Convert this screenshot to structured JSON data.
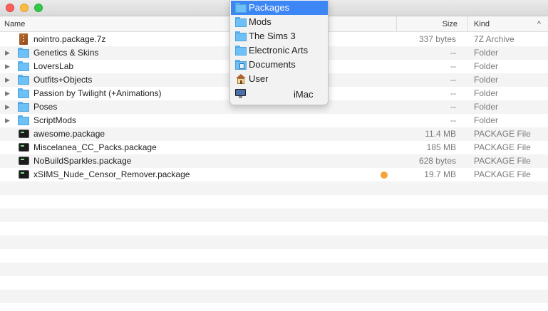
{
  "columns": {
    "name": "Name",
    "size": "Size",
    "kind": "Kind",
    "sort_indicator": "^"
  },
  "files": [
    {
      "name": "nointro.package.7z",
      "size": "337 bytes",
      "kind": "7Z Archive",
      "icon": "archive-icon",
      "expandable": false
    },
    {
      "name": "Genetics & Skins",
      "size": "--",
      "kind": "Folder",
      "icon": "folder-icon",
      "expandable": true
    },
    {
      "name": "LoversLab",
      "size": "--",
      "kind": "Folder",
      "icon": "folder-icon",
      "expandable": true
    },
    {
      "name": "Outfits+Objects",
      "size": "--",
      "kind": "Folder",
      "icon": "folder-icon",
      "expandable": true
    },
    {
      "name": "Passion by Twilight (+Animations)",
      "size": "--",
      "kind": "Folder",
      "icon": "folder-icon",
      "expandable": true
    },
    {
      "name": "Poses",
      "size": "--",
      "kind": "Folder",
      "icon": "folder-icon",
      "expandable": true
    },
    {
      "name": "ScriptMods",
      "size": "--",
      "kind": "Folder",
      "icon": "folder-icon",
      "expandable": true
    },
    {
      "name": "awesome.package",
      "size": "11.4 MB",
      "kind": "PACKAGE File",
      "icon": "terminal-icon",
      "expandable": false
    },
    {
      "name": "Miscelanea_CC_Packs.package",
      "size": "185 MB",
      "kind": "PACKAGE File",
      "icon": "terminal-icon",
      "expandable": false
    },
    {
      "name": "NoBuildSparkles.package",
      "size": "628 bytes",
      "kind": "PACKAGE File",
      "icon": "terminal-icon",
      "expandable": false
    },
    {
      "name": "xSIMS_Nude_Censor_Remover.package",
      "size": "19.7 MB",
      "kind": "PACKAGE File",
      "icon": "terminal-icon",
      "expandable": false,
      "tag_color": "#f5a33a"
    }
  ],
  "path_menu": {
    "items": [
      {
        "label": "Packages",
        "icon": "folder-icon",
        "selected": true
      },
      {
        "label": "Mods",
        "icon": "folder-icon"
      },
      {
        "label": "The Sims 3",
        "icon": "folder-icon"
      },
      {
        "label": "Electronic Arts",
        "icon": "folder-icon"
      },
      {
        "label": "Documents",
        "icon": "documents-folder-icon"
      },
      {
        "label": "User",
        "icon": "home-icon"
      },
      {
        "label": "iMac",
        "icon": "imac-icon"
      }
    ]
  },
  "colors": {
    "selection": "#3d86f5",
    "stripe": "#f4f4f5",
    "tag_orange": "#f5a33a"
  }
}
